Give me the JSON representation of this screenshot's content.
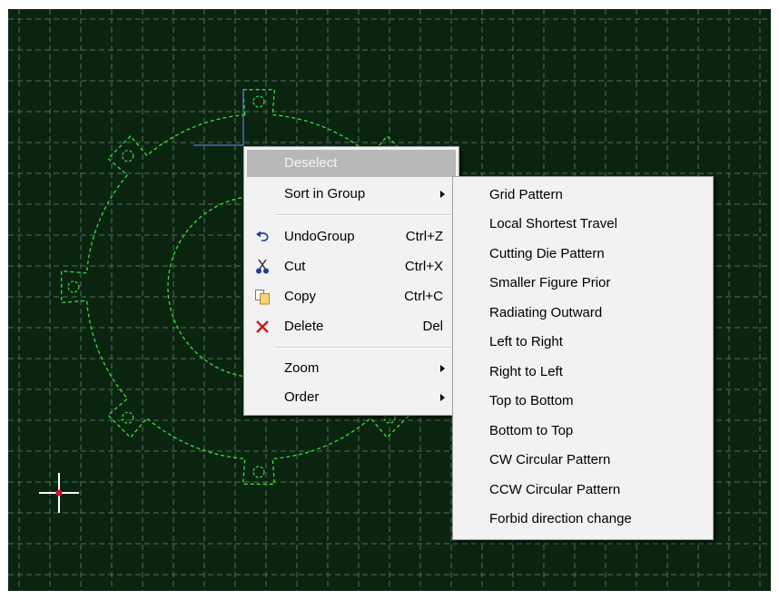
{
  "colors": {
    "canvas_bg": "#0a2410",
    "grid": "#4f6f57",
    "part": "#3ddc3d",
    "crosshair": "#ffffff",
    "crosshair_center": "#cc1133",
    "cursor_line": "#5c7bd0",
    "menu_bg": "#f2f2f2",
    "disabled_bg": "#b8b8b8"
  },
  "context_menu": {
    "items": [
      {
        "label": "Deselect",
        "disabled": true
      },
      {
        "label": "Sort in Group",
        "submenu": true
      },
      {
        "label": "UndoGroup",
        "shortcut": "Ctrl+Z",
        "icon": "undo-icon"
      },
      {
        "label": "Cut",
        "shortcut": "Ctrl+X",
        "icon": "scissors-icon"
      },
      {
        "label": "Copy",
        "shortcut": "Ctrl+C",
        "icon": "copy-icon"
      },
      {
        "label": "Delete",
        "shortcut": "Del",
        "icon": "delete-x-icon"
      },
      {
        "label": "Zoom",
        "submenu": true
      },
      {
        "label": "Order",
        "submenu": true
      }
    ]
  },
  "sort_submenu": {
    "items": [
      "Grid Pattern",
      "Local Shortest Travel",
      "Cutting Die Pattern",
      "Smaller Figure Prior",
      "Radiating Outward",
      "Left to Right",
      "Right to Left",
      "Top to Bottom",
      "Bottom to Top",
      "CW Circular Pattern",
      "CCW Circular Pattern",
      "Forbid direction change"
    ]
  }
}
